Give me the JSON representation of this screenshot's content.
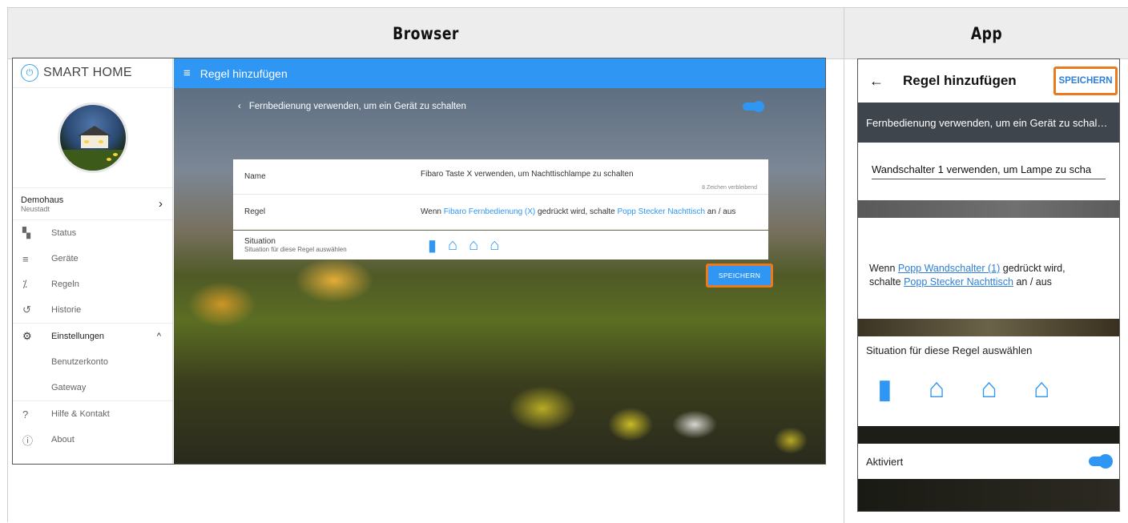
{
  "headers": {
    "browser": "Browser",
    "app": "App"
  },
  "browser": {
    "logo_text": "SMART HOME",
    "home": {
      "name": "Demohaus",
      "location": "Neustadt"
    },
    "nav": [
      {
        "label": "Status",
        "icon": "dashboard-icon"
      },
      {
        "label": "Geräte",
        "icon": "list-icon"
      },
      {
        "label": "Regeln",
        "icon": "magic-wand-icon"
      },
      {
        "label": "Historie",
        "icon": "history-icon"
      }
    ],
    "settings": {
      "label": "Einstellungen",
      "subitems": [
        "Benutzerkonto",
        "Gateway"
      ]
    },
    "help": "Hilfe & Kontakt",
    "about": "About",
    "topbar_title": "Regel hinzufügen",
    "panel_header": "Fernbedienung verwenden, um ein Gerät zu schalten",
    "name_label": "Name",
    "name_value": "Fibaro Taste X verwenden, um Nachttischlampe zu schalten",
    "name_hint": "8 Zeichen verbleibend",
    "rule_label": "Regel",
    "rule_pre": "Wenn ",
    "rule_device": "Fibaro Fernbedienung (X)",
    "rule_mid": " gedrückt wird, schalte ",
    "rule_target": "Popp Stecker Nachttisch",
    "rule_post": " an / aus",
    "situation_label": "Situation",
    "situation_sub": "Situation für diese Regel auswählen",
    "save": "SPEICHERN"
  },
  "app": {
    "title": "Regel hinzufügen",
    "save": "SPEICHERN",
    "header": "Fernbedienung verwenden, um ein Gerät zu schal…",
    "name_value": "Wandschalter 1 verwenden, um Lampe zu scha",
    "rule_pre": "Wenn ",
    "rule_device": "Popp Wandschalter (1)",
    "rule_mid": "  gedrückt wird,",
    "rule_line2_pre": "schalte ",
    "rule_target": "Popp Stecker Nachttisch",
    "rule_post": " an / aus",
    "situation_label": "Situation für diese Regel auswählen",
    "activated": "Aktiviert"
  },
  "colors": {
    "accent": "#2f97f3",
    "highlight": "#ea7a1d"
  }
}
